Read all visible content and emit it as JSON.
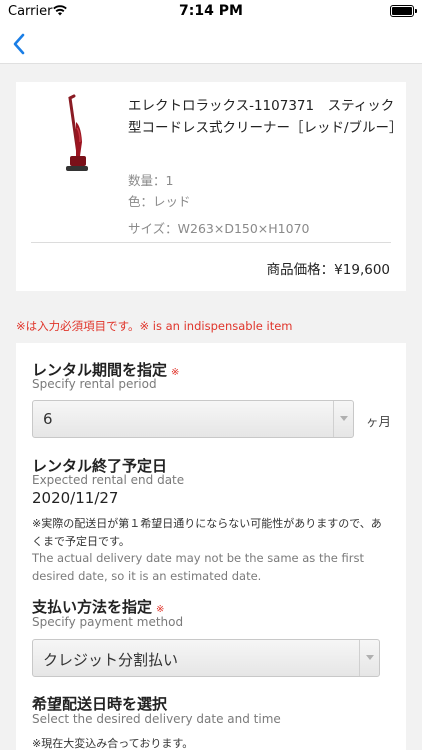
{
  "status_bar": {
    "carrier": "Carrier",
    "time": "7:14 PM"
  },
  "product": {
    "title": "エレクトロラックス-1107371　スティック型コードレス式クリーナー［レッド/ブルー］",
    "quantity": "数量：1",
    "color": "色：レッド",
    "size": "サイズ：W263×D150×H1070",
    "price": "商品価格：¥19,600"
  },
  "required_note": "※は入力必須項目です。※ is an indispensable item",
  "rental_period": {
    "label": "レンタル期間を指定",
    "required_mark": "※",
    "sub": "Specify rental period",
    "value": "6",
    "unit": "ヶ月"
  },
  "rental_end": {
    "label": "レンタル終了予定日",
    "sub": "Expected rental end date",
    "date": "2020/11/27",
    "note_ja": "※実際の配送日が第１希望日通りにならない可能性がありますので、あくまで予定日です。",
    "note_en": "The actual delivery date may not be the same as the first desired date, so it is an estimated date."
  },
  "payment": {
    "label": "支払い方法を指定",
    "required_mark": "※",
    "sub": "Specify payment method",
    "value": "クレジット分割払い"
  },
  "delivery": {
    "label": "希望配送日時を選択",
    "sub": "Select the desired delivery date and time",
    "note_ja": "※現在大変込み合っております。"
  },
  "colors": {
    "required": "#e0352b",
    "accent": "#1a7ee6",
    "product_red": "#9b1420"
  },
  "icons": {
    "back": "chevron-left-icon",
    "wifi": "wifi-icon",
    "battery": "battery-icon"
  }
}
